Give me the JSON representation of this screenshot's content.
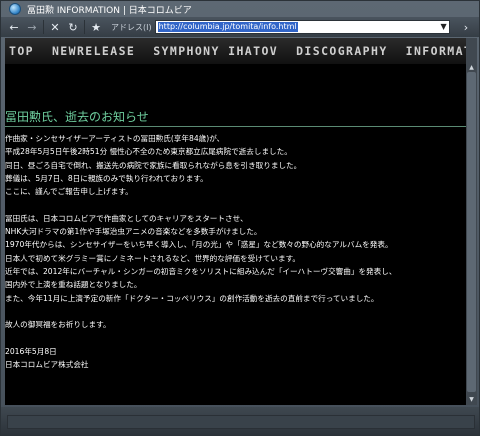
{
  "window": {
    "title": "冨田勲 INFORMATION | 日本コロムビア"
  },
  "toolbar": {
    "back_icon": "back-arrow-icon",
    "forward_icon": "forward-arrow-icon",
    "stop_icon": "stop-icon",
    "reload_icon": "reload-icon",
    "favorite_icon": "star-icon",
    "address_label": "アドレス(I)",
    "address_value": "http://columbia.jp/tomita/info.html",
    "go_icon": "go-arrow-icon"
  },
  "nav": {
    "items": [
      "TOP",
      "NEWRELEASE",
      "SYMPHONY IHATOV",
      "DISCOGRAPHY",
      "INFORMAT"
    ]
  },
  "article": {
    "heading": "冨田勲氏、逝去のお知らせ",
    "lines": [
      "作曲家・シンセサイザーアーティストの冨田勲氏(享年84歳)が、",
      "平成28年5月5日午後2時51分 慢性心不全のため東京都立広尾病院で逝去しました。",
      "同日、昼ごろ自宅で倒れ、搬送先の病院で家族に看取られながら息を引き取りました。",
      "葬儀は、5月7日、8日に親族のみで執り行われております。",
      "ここに、謹んでご報告申し上げます。",
      "",
      "冨田氏は、日本コロムビアで作曲家としてのキャリアをスタートさせ、",
      "NHK大河ドラマの第1作や手塚治虫アニメの音楽などを多数手がけました。",
      "1970年代からは、シンセサイザーをいち早く導入し、「月の光」や「惑星」など数々の野心的なアルバムを発表。",
      "日本人で初めて米グラミー賞にノミネートされるなど、世界的な評価を受けています。",
      "近年では、2012年にバーチャル・シンガーの初音ミクをソリストに組み込んだ「イーハトーヴ交響曲」を発表し、",
      "国内外で上演を重ね話題となりました。",
      "また、今年11月に上演予定の新作「ドクター・コッペリウス」の創作活動を逝去の直前まで行っていました。",
      "",
      "故人の御冥福をお祈りします。",
      "",
      "2016年5月8日",
      "日本コロムビア株式会社"
    ]
  },
  "colors": {
    "heading": "#6fcf9f",
    "background": "#000000",
    "text": "#ffffff",
    "chrome": "#4a5560"
  }
}
